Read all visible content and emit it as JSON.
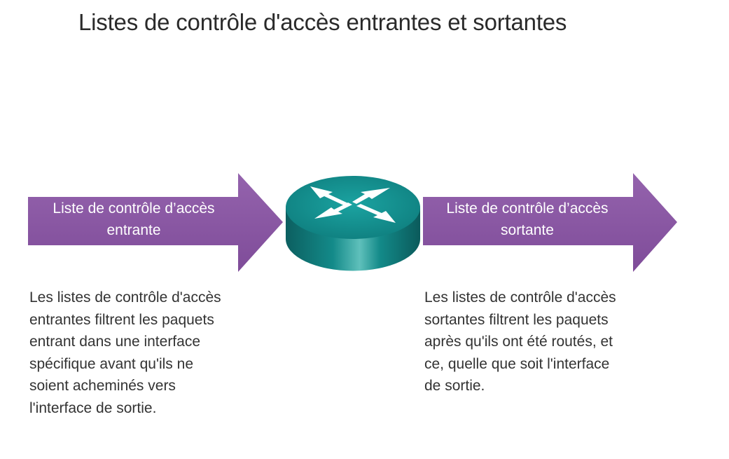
{
  "title": "Listes de contrôle d'accès entrantes et sortantes",
  "colors": {
    "arrow": "#8a57a3",
    "router_top": "#14908f",
    "router_side": "#0f6f70",
    "router_arrows": "#ffffff"
  },
  "inbound": {
    "label_lines": [
      "Liste de contrôle d’accès",
      "entrante"
    ],
    "description_lines": [
      "Les listes de contrôle d'accès",
      "entrantes filtrent les paquets",
      "entrant dans une interface",
      "spécifique avant qu'ils ne",
      "soient acheminés vers",
      "l'interface de sortie."
    ]
  },
  "router": {
    "icon": "router-icon"
  },
  "outbound": {
    "label_lines": [
      "Liste de contrôle d’accès",
      "sortante"
    ],
    "description_lines": [
      "Les listes de contrôle d'accès",
      "sortantes filtrent les paquets",
      "après qu'ils ont été routés, et",
      "ce, quelle que soit l'interface",
      "de sortie."
    ]
  }
}
